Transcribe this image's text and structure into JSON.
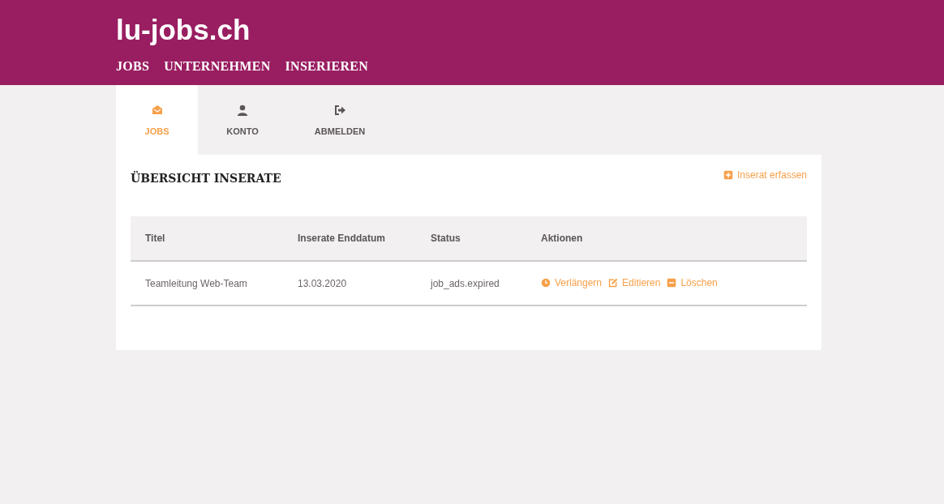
{
  "site": {
    "logo": "lu-jobs.ch",
    "nav": [
      {
        "label": "JOBS"
      },
      {
        "label": "UNTERNEHMEN"
      },
      {
        "label": "INSERIEREN"
      }
    ]
  },
  "tabs": [
    {
      "label": "JOBS",
      "kind": "envelope",
      "selected": true
    },
    {
      "label": "KONTO",
      "kind": "user",
      "selected": false
    },
    {
      "label": "ABMELDEN",
      "kind": "logout",
      "selected": false
    }
  ],
  "panel": {
    "title": "ÜBERSICHT INSERATE",
    "add_link": "Inserat erfassen",
    "table": {
      "columns": [
        "Titel",
        "Inserate Enddatum",
        "Status",
        "Aktionen"
      ],
      "rows": [
        {
          "cells": [
            "Teamleitung Web-Team",
            "13.03.2020",
            "job_ads.expired"
          ],
          "actions": [
            {
              "label": "Verlängern",
              "kind": "clock"
            },
            {
              "label": "Editieren",
              "kind": "edit"
            },
            {
              "label": "Löschen",
              "kind": "minus"
            }
          ]
        }
      ]
    }
  }
}
